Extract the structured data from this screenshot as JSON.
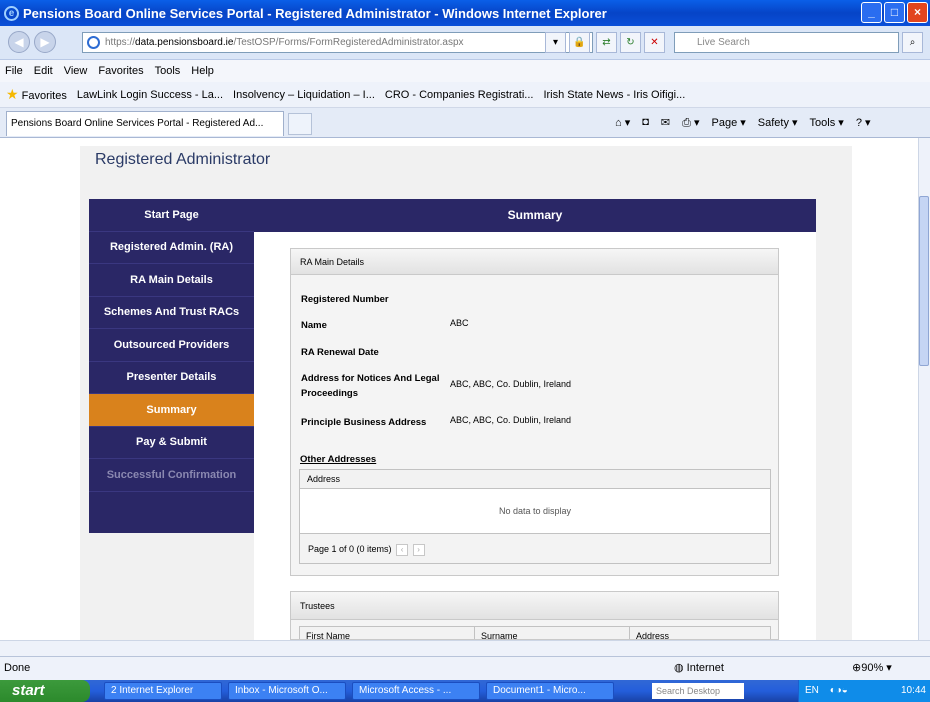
{
  "window": {
    "title": "Pensions Board Online Services Portal - Registered Administrator - Windows Internet Explorer"
  },
  "address": {
    "scheme": "https://",
    "host": "data.pensionsboard.ie",
    "path": "/TestOSP/Forms/FormRegisteredAdministrator.aspx",
    "search_placeholder": "Live Search"
  },
  "menu": [
    "File",
    "Edit",
    "View",
    "Favorites",
    "Tools",
    "Help"
  ],
  "favorites": {
    "label": "Favorites",
    "links": [
      "LawLink Login Success - La...",
      "Insolvency – Liquidation – I...",
      "CRO - Companies Registrati...",
      "Irish State News - Iris Oifigi..."
    ]
  },
  "tab": {
    "title": "Pensions Board Online Services Portal - Registered Ad..."
  },
  "commandbar": {
    "page": "Page ▾",
    "safety": "Safety ▾",
    "tools": "Tools ▾"
  },
  "page": {
    "header": "Registered Administrator",
    "section_title": "Summary",
    "sidebar": [
      {
        "label": "Start Page",
        "state": "normal"
      },
      {
        "label": "Registered Admin. (RA)",
        "state": "normal"
      },
      {
        "label": "RA Main Details",
        "state": "normal"
      },
      {
        "label": "Schemes And Trust RACs",
        "state": "normal"
      },
      {
        "label": "Outsourced Providers",
        "state": "normal"
      },
      {
        "label": "Presenter Details",
        "state": "normal"
      },
      {
        "label": "Summary",
        "state": "active"
      },
      {
        "label": "Pay & Submit",
        "state": "normal"
      },
      {
        "label": "Successful Confirmation",
        "state": "disabled"
      }
    ],
    "main_details": {
      "title": "RA Main Details",
      "fields": [
        {
          "label": "Registered Number",
          "value": ""
        },
        {
          "label": "Name",
          "value": "ABC"
        },
        {
          "label": "RA Renewal Date",
          "value": ""
        },
        {
          "label": "Address for Notices And Legal Proceedings",
          "value": "ABC, ABC, Co. Dublin, Ireland"
        },
        {
          "label": "Principle Business Address",
          "value": "ABC, ABC, Co. Dublin, Ireland"
        }
      ]
    },
    "other_addresses": {
      "title": "Other Addresses",
      "column": "Address",
      "empty": "No data to display",
      "pager": "Page 1 of 0 (0 items)"
    },
    "trustees": {
      "title": "Trustees",
      "columns": [
        "First Name",
        "Surname",
        "Address"
      ]
    }
  },
  "status": {
    "text": "Done",
    "zone": "Internet",
    "zoom": "90%"
  },
  "taskbar": {
    "start": "start",
    "tasks": [
      "2 Internet Explorer",
      "Inbox - Microsoft O...",
      "Microsoft Access - ...",
      "Document1 - Micro..."
    ],
    "search_placeholder": "Search Desktop",
    "lang": "EN",
    "time": "10:44"
  }
}
